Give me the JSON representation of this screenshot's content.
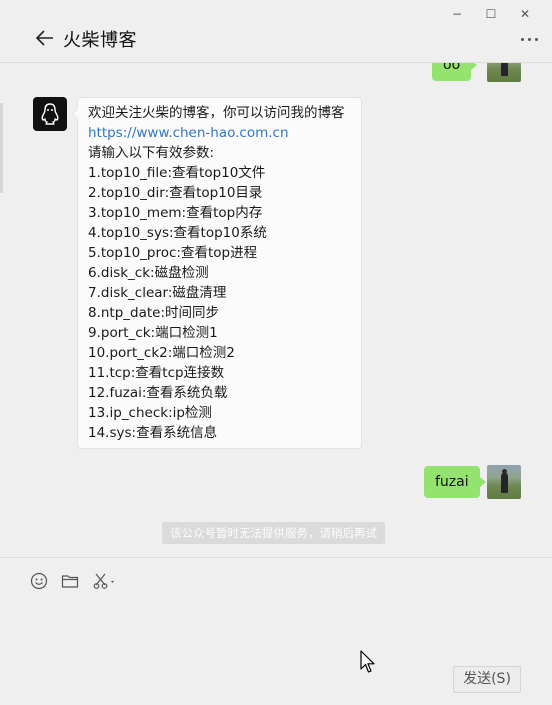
{
  "window": {
    "controls": [
      "−",
      "☐",
      "✕"
    ]
  },
  "header": {
    "title": "火柴博客",
    "back_icon": "arrow-left-icon",
    "more_icon": "more-dots-icon"
  },
  "messages": [
    {
      "side": "right",
      "type": "text",
      "text": "oo"
    },
    {
      "side": "left",
      "type": "text",
      "lines": [
        "欢迎关注火柴的博客，你可以访问我的博客",
        "https://www.chen-hao.com.cn",
        "请输入以下有效参数:",
        "1.top10_file:查看top10文件",
        "2.top10_dir:查看top10目录",
        "3.top10_mem:查看top内存",
        "4.top10_sys:查看top10系统",
        "5.top10_proc:查看top进程",
        "6.disk_ck:磁盘检测",
        "7.disk_clear:磁盘清理",
        "8.ntp_date:时间同步",
        "9.port_ck:端口检测1",
        "10.port_ck2:端口检测2",
        "11.tcp:查看tcp连接数",
        "12.fuzai:查看系统负载",
        "13.ip_check:ip检测",
        "14.sys:查看系统信息"
      ]
    },
    {
      "side": "right",
      "type": "text",
      "text": "fuzai"
    }
  ],
  "system_notice": "该公众号暂时无法提供服务，请稍后再试",
  "input": {
    "toolbar_icons": [
      "emoji-icon",
      "folder-icon",
      "scissors-icon"
    ],
    "send_label": "发送(S)"
  },
  "colors": {
    "background": "#efefef",
    "own_bubble": "#95e36f",
    "link": "#2f77c9"
  }
}
